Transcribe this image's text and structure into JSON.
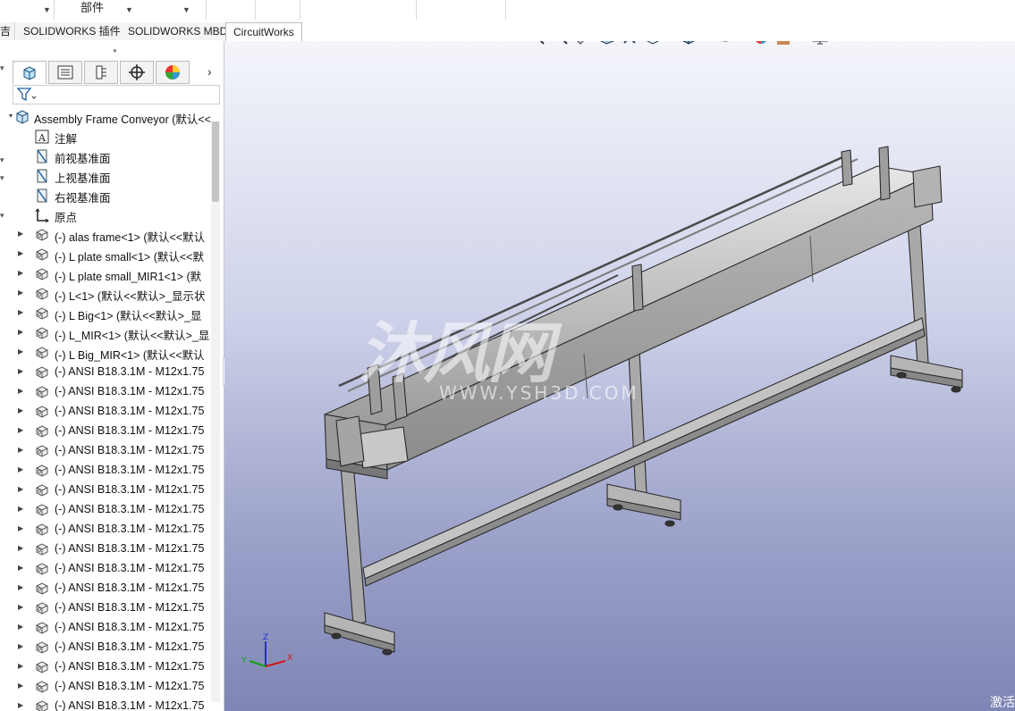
{
  "ribbon": {
    "label": "部件"
  },
  "tabs": [
    {
      "label": "SOLIDWORKS 插件",
      "active": false
    },
    {
      "label": "SOLIDWORKS MBD",
      "active": false
    },
    {
      "label": "CircuitWorks",
      "active": true
    }
  ],
  "feature_manager": {
    "tabs": [
      "feature-manager-icon",
      "property-manager-icon",
      "configuration-manager-icon",
      "dimxpert-icon",
      "display-manager-icon"
    ],
    "filter_icon": "filter-icon",
    "root": "Assembly Frame Conveyor  (默认<<",
    "items": [
      {
        "label": "注解",
        "icon": "annotation-icon",
        "expandable": false
      },
      {
        "label": "前视基准面",
        "icon": "plane-icon",
        "expandable": false
      },
      {
        "label": "上视基准面",
        "icon": "plane-icon",
        "expandable": false
      },
      {
        "label": "右视基准面",
        "icon": "plane-icon",
        "expandable": false
      },
      {
        "label": "原点",
        "icon": "origin-icon",
        "expandable": false
      },
      {
        "label": "(-) alas frame<1> (默认<<默认",
        "icon": "part-icon",
        "expandable": true
      },
      {
        "label": "(-) L plate small<1> (默认<<默",
        "icon": "part-icon",
        "expandable": true
      },
      {
        "label": "(-) L plate small_MIR1<1> (默",
        "icon": "part-icon",
        "expandable": true
      },
      {
        "label": "(-) L<1> (默认<<默认>_显示状",
        "icon": "part-icon",
        "expandable": true
      },
      {
        "label": "(-) L Big<1> (默认<<默认>_显",
        "icon": "part-icon",
        "expandable": true
      },
      {
        "label": "(-) L_MIR<1> (默认<<默认>_显",
        "icon": "part-icon",
        "expandable": true
      },
      {
        "label": "(-) L Big_MIR<1> (默认<<默认",
        "icon": "part-icon",
        "expandable": true
      },
      {
        "label": "(-) ANSI B18.3.1M - M12x1.75",
        "icon": "part-icon",
        "expandable": true
      },
      {
        "label": "(-) ANSI B18.3.1M - M12x1.75",
        "icon": "part-icon",
        "expandable": true
      },
      {
        "label": "(-) ANSI B18.3.1M - M12x1.75",
        "icon": "part-icon",
        "expandable": true
      },
      {
        "label": "(-) ANSI B18.3.1M - M12x1.75",
        "icon": "part-icon",
        "expandable": true
      },
      {
        "label": "(-) ANSI B18.3.1M - M12x1.75",
        "icon": "part-icon",
        "expandable": true
      },
      {
        "label": "(-) ANSI B18.3.1M - M12x1.75",
        "icon": "part-icon",
        "expandable": true
      },
      {
        "label": "(-) ANSI B18.3.1M - M12x1.75",
        "icon": "part-icon",
        "expandable": true
      },
      {
        "label": "(-) ANSI B18.3.1M - M12x1.75",
        "icon": "part-icon",
        "expandable": true
      },
      {
        "label": "(-) ANSI B18.3.1M - M12x1.75",
        "icon": "part-icon",
        "expandable": true
      },
      {
        "label": "(-) ANSI B18.3.1M - M12x1.75",
        "icon": "part-icon",
        "expandable": true
      },
      {
        "label": "(-) ANSI B18.3.1M - M12x1.75",
        "icon": "part-icon",
        "expandable": true
      },
      {
        "label": "(-) ANSI B18.3.1M - M12x1.75",
        "icon": "part-icon",
        "expandable": true
      },
      {
        "label": "(-) ANSI B18.3.1M - M12x1.75",
        "icon": "part-icon",
        "expandable": true
      },
      {
        "label": "(-) ANSI B18.3.1M - M12x1.75",
        "icon": "part-icon",
        "expandable": true
      },
      {
        "label": "(-) ANSI B18.3.1M - M12x1.75",
        "icon": "part-icon",
        "expandable": true
      },
      {
        "label": "(-) ANSI B18.3.1M - M12x1.75",
        "icon": "part-icon",
        "expandable": true
      },
      {
        "label": "(-) ANSI B18.3.1M - M12x1.75",
        "icon": "part-icon",
        "expandable": true
      },
      {
        "label": "(-) ANSI B18.3.1M - M12x1.75",
        "icon": "part-icon",
        "expandable": true
      }
    ]
  },
  "viewport": {
    "hud_icons": [
      "zoom-to-fit-icon",
      "zoom-to-area-icon",
      "previous-view-icon",
      "section-view-icon",
      "dynamic-annotation-icon",
      "view-orientation-icon",
      "display-style-icon",
      "hide-show-items-icon",
      "edit-appearance-icon",
      "apply-scene-icon",
      "view-settings-icon"
    ],
    "watermark_logo": "沐风网",
    "watermark_url": "WWW.YSH3D.COM",
    "corner_text": "激活",
    "triad_labels": {
      "x": "X",
      "y": "Y",
      "z": "Z"
    },
    "model_name": "conveyor-frame-model"
  }
}
